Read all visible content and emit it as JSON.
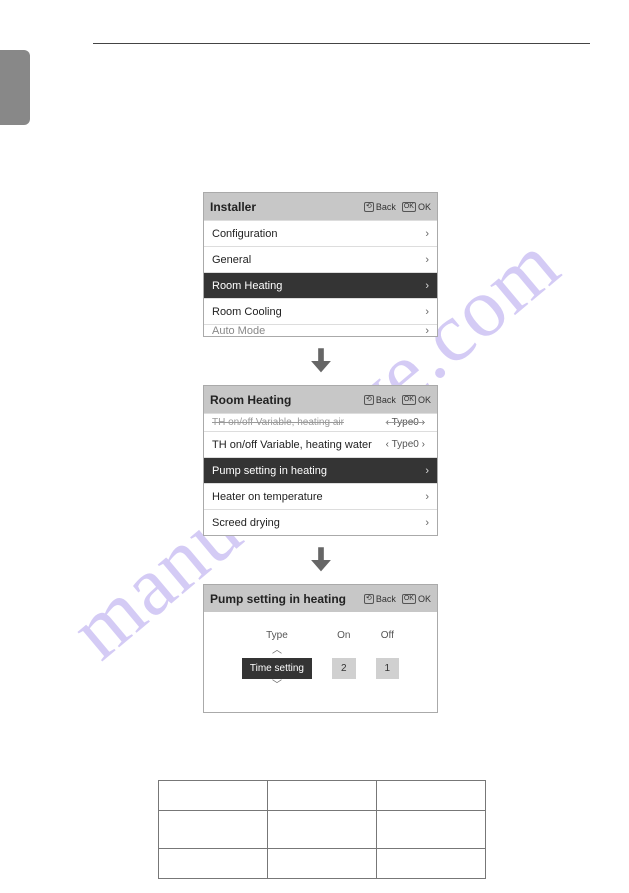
{
  "watermark_text": "manualshive.com",
  "panel1": {
    "title": "Installer",
    "back_label": "Back",
    "ok_label": "OK",
    "items": [
      {
        "label": "Configuration",
        "selected": false
      },
      {
        "label": "General",
        "selected": false
      },
      {
        "label": "Room Heating",
        "selected": true
      },
      {
        "label": "Room Cooling",
        "selected": false
      }
    ],
    "peek_label": "Auto Mode"
  },
  "panel2": {
    "title": "Room Heating",
    "back_label": "Back",
    "ok_label": "OK",
    "items": [
      {
        "label": "TH on/off Variable, heating air",
        "struck": true,
        "value_prefix": "‹",
        "value": "Type0",
        "value_suffix": "›"
      },
      {
        "label": "TH on/off Variable, heating water",
        "value_prefix": "‹",
        "value": "Type0",
        "value_suffix": "›"
      },
      {
        "label": "Pump setting in heating",
        "selected": true
      },
      {
        "label": "Heater on temperature"
      },
      {
        "label": "Screed drying"
      }
    ]
  },
  "panel3": {
    "title": "Pump setting in heating",
    "back_label": "Back",
    "ok_label": "OK",
    "columns": [
      {
        "header": "Type",
        "value": "Time setting",
        "selected": true,
        "has_carets": true
      },
      {
        "header": "On",
        "value": "2"
      },
      {
        "header": "Off",
        "value": "1"
      }
    ]
  },
  "icons": {
    "back": "⟲",
    "ok": "OK"
  }
}
